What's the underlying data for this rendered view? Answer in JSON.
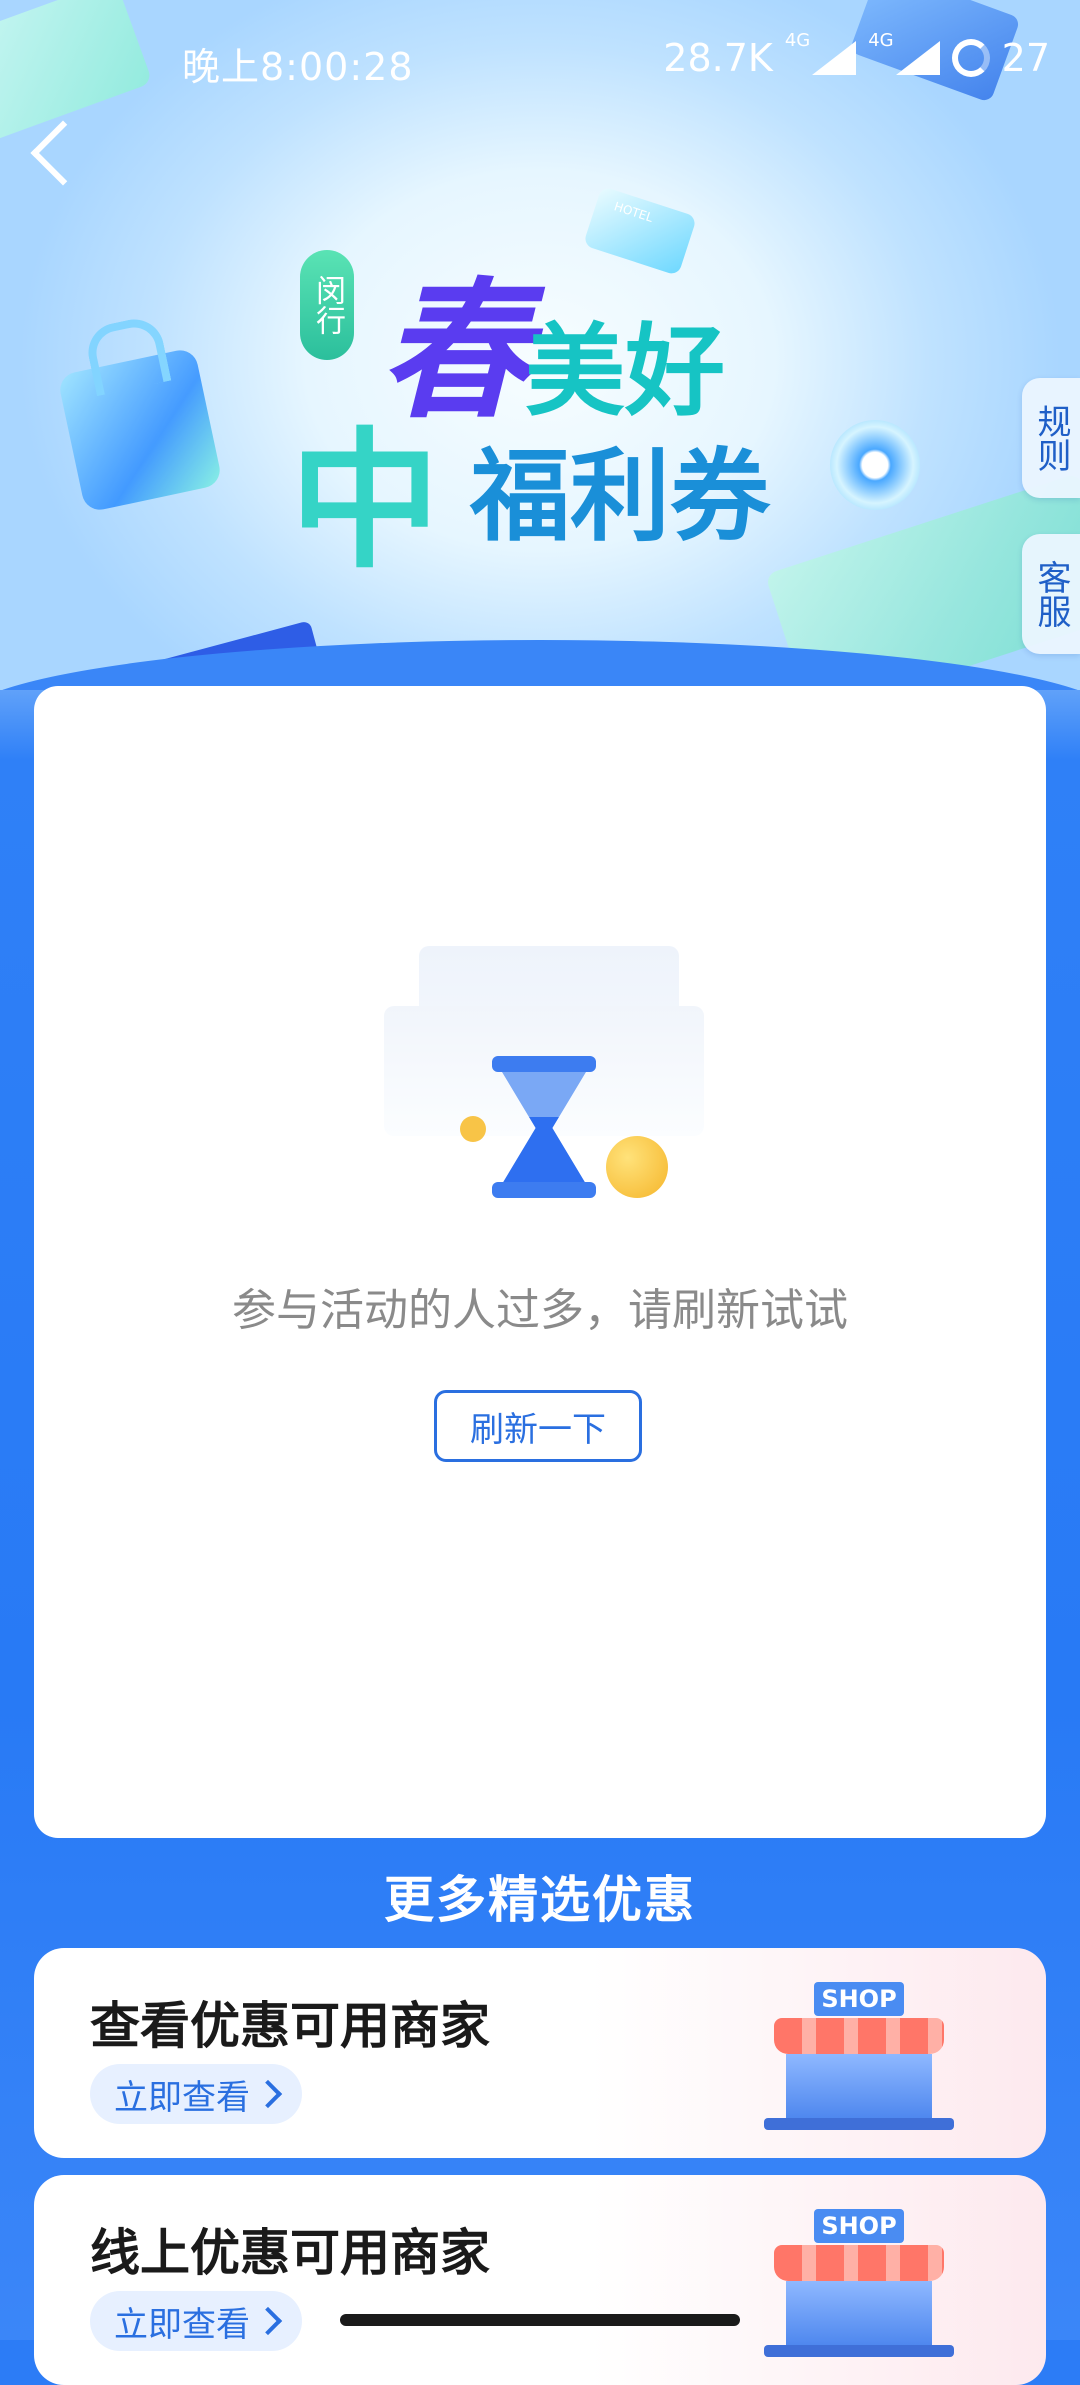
{
  "status_bar": {
    "time": "晚上8:00:28",
    "net_speed": "28.7K",
    "sig1_label": "4G",
    "sig2_label": "4G",
    "battery": "27"
  },
  "hero": {
    "tag": "闵行",
    "title_chun": "春",
    "title_meihao": "美好",
    "title_zhong": "中",
    "title_fuli": "福利券",
    "hotel_label": "HOTEL"
  },
  "side_tabs": {
    "rules": "规则",
    "service": "客服"
  },
  "main": {
    "empty_message": "参与活动的人过多，请刷新试试",
    "refresh_button": "刷新一下"
  },
  "more_section": {
    "title": "更多精选优惠",
    "cards": [
      {
        "title": "查看优惠可用商家",
        "button": "立即查看",
        "shop_sign": "SHOP"
      },
      {
        "title": "线上优惠可用商家",
        "button": "立即查看",
        "shop_sign": "SHOP"
      }
    ]
  }
}
